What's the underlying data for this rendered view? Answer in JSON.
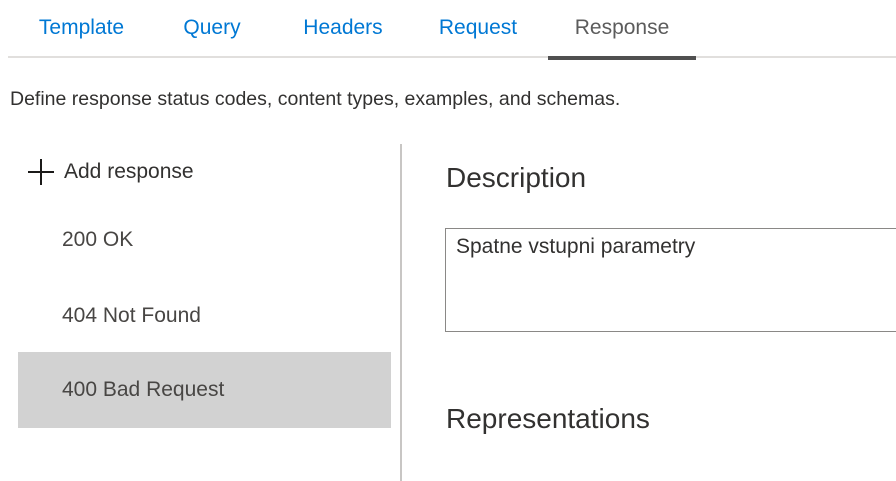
{
  "tabs": [
    {
      "label": "Template",
      "active": false
    },
    {
      "label": "Query",
      "active": false
    },
    {
      "label": "Headers",
      "active": false
    },
    {
      "label": "Request",
      "active": false
    },
    {
      "label": "Response",
      "active": true
    }
  ],
  "intro_text": "Define response status codes, content types, examples, and schemas.",
  "responses_panel": {
    "add_label": "Add response",
    "add_icon": "plus-icon",
    "items": [
      {
        "label": "200 OK",
        "selected": false
      },
      {
        "label": "404 Not Found",
        "selected": false
      },
      {
        "label": "400 Bad Request",
        "selected": true
      }
    ]
  },
  "detail": {
    "description_heading": "Description",
    "description_value": "Spatne vstupni parametry",
    "representations_heading": "Representations"
  },
  "colors": {
    "link": "#0078d4",
    "active_tab_underline": "#505050",
    "selected_item_bg": "#d2d2d2"
  }
}
